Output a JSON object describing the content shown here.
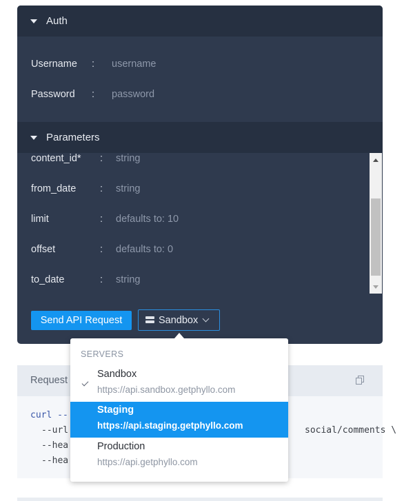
{
  "auth": {
    "title": "Auth",
    "fields": [
      {
        "label": "Username",
        "placeholder": "username"
      },
      {
        "label": "Password",
        "placeholder": "password"
      }
    ]
  },
  "parameters": {
    "title": "Parameters",
    "items": [
      {
        "name": "content_id*",
        "value": "string"
      },
      {
        "name": "from_date",
        "value": "string"
      },
      {
        "name": "limit",
        "value": "defaults to: 10"
      },
      {
        "name": "offset",
        "value": "defaults to: 0"
      },
      {
        "name": "to_date",
        "value": "string"
      }
    ]
  },
  "actions": {
    "send_label": "Send API Request",
    "server_label": "Sandbox"
  },
  "server_dropdown": {
    "header": "SERVERS",
    "options": [
      {
        "name": "Sandbox",
        "url": "https://api.sandbox.getphyllo.com",
        "checked": true
      },
      {
        "name": "Staging",
        "url": "https://api.staging.getphyllo.com",
        "highlighted": true
      },
      {
        "name": "Production",
        "url": "https://api.getphyllo.com"
      }
    ]
  },
  "request": {
    "title": "Request",
    "code_lines": [
      "curl --",
      "--url",
      "social/comments \\",
      "--hea",
      "--hea"
    ]
  },
  "colors": {
    "panel_bg": "#2f3a4e",
    "header_bg": "#263041",
    "accent": "#1495f0"
  }
}
